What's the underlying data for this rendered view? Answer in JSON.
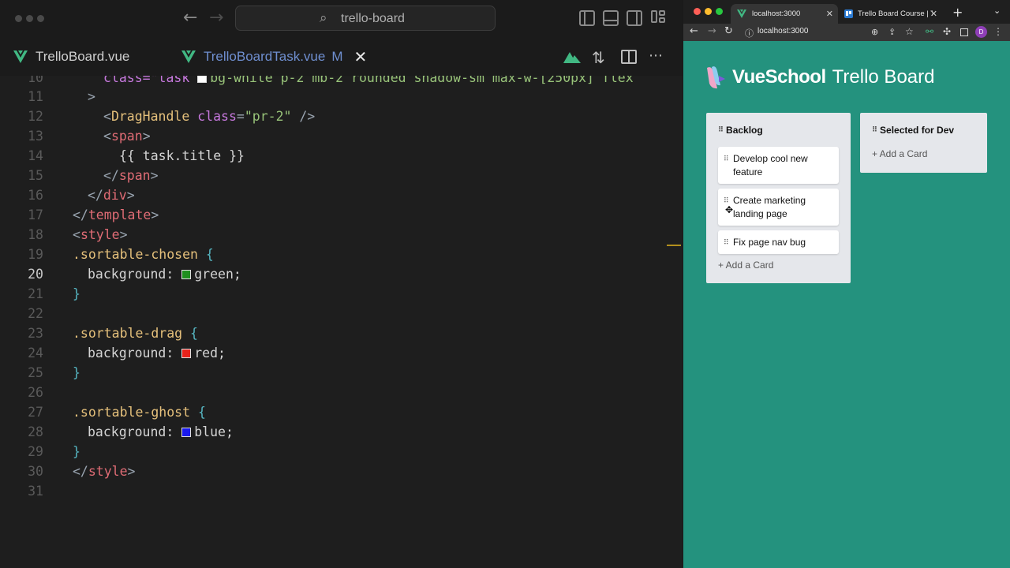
{
  "editor": {
    "search": {
      "text": "trello-board"
    },
    "tabs": [
      {
        "label": "TrelloBoard.vue",
        "modified": ""
      },
      {
        "label": "TrelloBoardTask.vue",
        "modified": "M"
      }
    ],
    "code_lines": [
      {
        "n": "10"
      },
      {
        "n": "11"
      },
      {
        "n": "12"
      },
      {
        "n": "13"
      },
      {
        "n": "14"
      },
      {
        "n": "15"
      },
      {
        "n": "16"
      },
      {
        "n": "17"
      },
      {
        "n": "18"
      },
      {
        "n": "19"
      },
      {
        "n": "20"
      },
      {
        "n": "21"
      },
      {
        "n": "22"
      },
      {
        "n": "23"
      },
      {
        "n": "24"
      },
      {
        "n": "25"
      },
      {
        "n": "26"
      },
      {
        "n": "27"
      },
      {
        "n": "28"
      },
      {
        "n": "29"
      },
      {
        "n": "30"
      },
      {
        "n": "31"
      }
    ],
    "code": {
      "l10": "class=\"task ",
      "l10b": "bg-white p-2 mb-2 rounded shadow-sm max-w-[250px] flex",
      "l11": ">",
      "l12_tag": "DragHandle",
      "l12_attr": "class",
      "l12_val": "\"pr-2\"",
      "l13_tag": "span",
      "l14": "{{ task.title }}",
      "l15_tag": "span",
      "l16_tag": "div",
      "l17_tag": "template",
      "l18_tag": "style",
      "l19_sel": ".sortable-chosen",
      "l20_prop": "background:",
      "l20_val": "green;",
      "l23_sel": ".sortable-drag",
      "l24_prop": "background:",
      "l24_val": "red;",
      "l27_sel": ".sortable-ghost",
      "l28_prop": "background:",
      "l28_val": "blue;",
      "l30_tag": "style",
      "open_brace": "{",
      "close_brace": "}"
    },
    "colors": {
      "green": "#1f8f1f",
      "red": "#e8221b",
      "blue": "#1a1aee",
      "vue": "#41b883"
    }
  },
  "browser": {
    "tabs": [
      {
        "label": "localhost:3000"
      },
      {
        "label": "Trello Board Course | Tre"
      }
    ],
    "url": "localhost:3000",
    "avatar": "D",
    "brand": {
      "vs": "VueSchool",
      "title": "Trello Board"
    },
    "columns": [
      {
        "title": "Backlog",
        "cards": [
          "Develop cool new feature",
          "Create marketing landing page",
          "Fix page nav bug"
        ],
        "add_label": "+ Add a Card"
      },
      {
        "title": "Selected for Dev",
        "cards": [],
        "add_label": "+ Add a Card"
      }
    ]
  }
}
